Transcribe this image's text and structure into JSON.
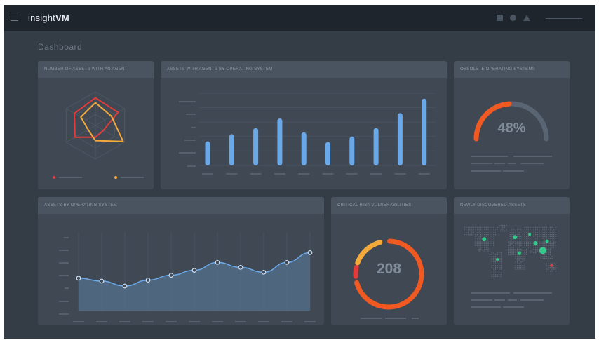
{
  "app": {
    "brand_light": "insight",
    "brand_bold": "VM"
  },
  "topbar": {
    "icons": [
      "square-icon",
      "circle-icon",
      "triangle-icon",
      "user-menu-line"
    ]
  },
  "page": {
    "title": "Dashboard"
  },
  "colors": {
    "orange": "#f05a22",
    "yellow": "#f4a93b",
    "red": "#e23b3b",
    "blue": "#6aa9e9",
    "green": "#34c98b",
    "track": "#5a6573",
    "bg": "#343c46",
    "card": "#3f4853"
  },
  "cards": {
    "agents": {
      "title": "NUMBER OF ASSETS WITH AN AGENT"
    },
    "os_agents": {
      "title": "ASSETS WITH AGENTS BY OPERATING SYSTEM"
    },
    "obsolete": {
      "title": "OBSOLETE OPERATING SYSTEMS",
      "value": "48%"
    },
    "assets_os": {
      "title": "ASSETS BY OPERATING SYSTEM"
    },
    "critical": {
      "title": "CRITICAL RISK VULNERABILITIES",
      "value": "208"
    },
    "new": {
      "title": "NEWLY DISCOVERED ASSETS"
    }
  },
  "chart_data": [
    {
      "type": "radar",
      "series": [
        {
          "color": "#e23b3b",
          "values": [
            0.82,
            0.78,
            0.28,
            0.35,
            0.7,
            0.72
          ]
        },
        {
          "color": "#f4a93b",
          "values": [
            0.68,
            0.55,
            0.95,
            0.45,
            0.25,
            0.5
          ]
        }
      ]
    },
    {
      "type": "bar",
      "values": [
        4,
        5.2,
        6.2,
        7.8,
        5.5,
        3.9,
        4.8,
        6.2,
        8.7,
        11.1
      ],
      "ylim": [
        0,
        12
      ],
      "color": "#6aa9e9"
    },
    {
      "type": "gauge",
      "value": 48,
      "color": "#f05a22"
    },
    {
      "type": "area",
      "values": [
        3.3,
        3.0,
        2.5,
        3.1,
        3.6,
        4.1,
        4.9,
        4.4,
        3.9,
        4.9,
        5.9
      ],
      "ylim": [
        0,
        8
      ],
      "color": "#6aa9e9"
    },
    {
      "type": "donut",
      "value": 208,
      "segments": [
        {
          "color": "#f05a22",
          "fraction": 0.7
        },
        {
          "color": "#e23b3b",
          "fraction": 0.04
        },
        {
          "color": "#f4a93b",
          "fraction": 0.15
        }
      ]
    },
    {
      "type": "map",
      "points": [
        {
          "lon": -95,
          "lat": 40,
          "size": 3,
          "color": "#34c98b"
        },
        {
          "lon": -50,
          "lat": -10,
          "size": 2,
          "color": "#34c98b"
        },
        {
          "lon": 10,
          "lat": 45,
          "size": 3,
          "color": "#34c98b"
        },
        {
          "lon": 25,
          "lat": 5,
          "size": 2.5,
          "color": "#34c98b"
        },
        {
          "lon": 80,
          "lat": 30,
          "size": 3,
          "color": "#34c98b"
        },
        {
          "lon": 105,
          "lat": 12,
          "size": 5,
          "color": "#34c98b"
        },
        {
          "lon": 120,
          "lat": 35,
          "size": 2.5,
          "color": "#34c98b"
        },
        {
          "lon": 135,
          "lat": -25,
          "size": 2,
          "color": "#e23b3b"
        },
        {
          "lon": 60,
          "lat": 52,
          "size": 2,
          "color": "#34c98b"
        }
      ]
    }
  ]
}
